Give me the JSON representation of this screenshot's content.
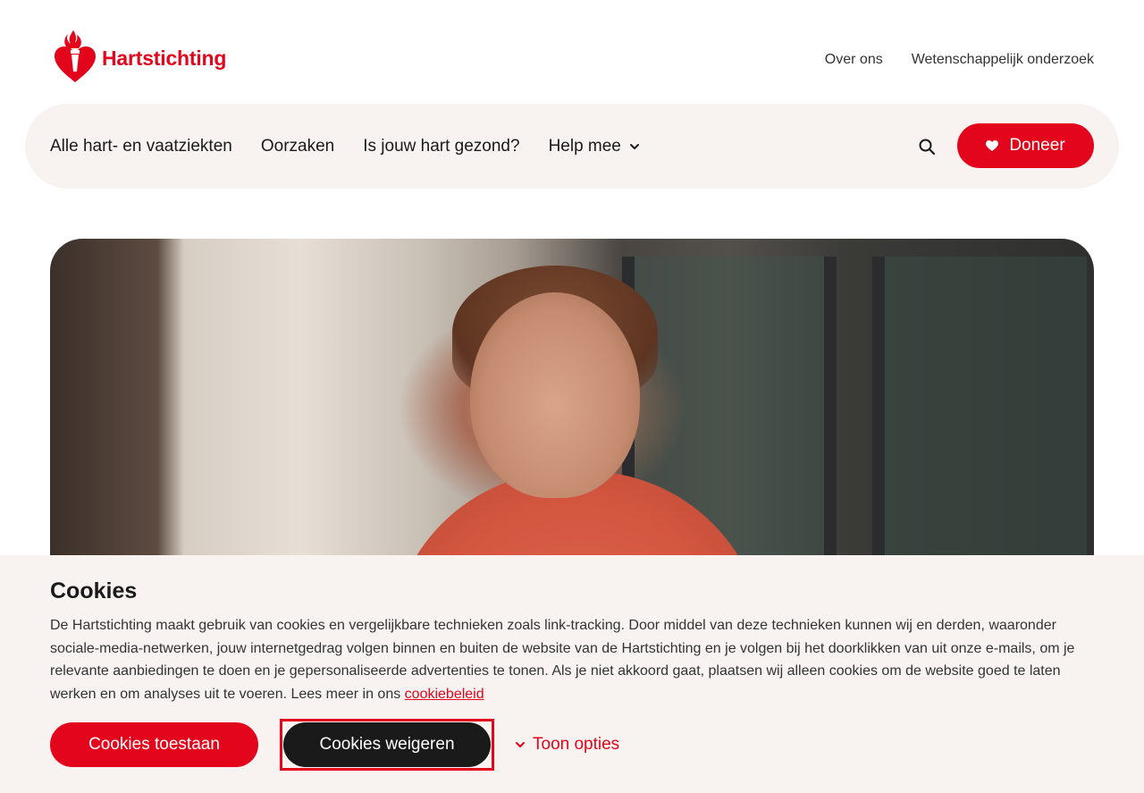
{
  "brand": {
    "name": "Hartstichting",
    "accent": "#e3051b",
    "logo_icon": "heart-torch-icon"
  },
  "utility_nav": [
    {
      "label": "Over ons"
    },
    {
      "label": "Wetenschappelijk onderzoek"
    }
  ],
  "main_nav": {
    "items": [
      {
        "label": "Alle hart- en vaatziekten"
      },
      {
        "label": "Oorzaken"
      },
      {
        "label": "Is jouw hart gezond?"
      },
      {
        "label": "Help mee",
        "has_dropdown": true
      }
    ],
    "search_icon": "search-icon",
    "donate_label": "Doneer",
    "donate_icon": "heart-icon"
  },
  "hero": {
    "image_description": ""
  },
  "cookie_banner": {
    "title": "Cookies",
    "body": "De Hartstichting maakt gebruik van cookies en vergelijkbare technieken zoals link-tracking. Door middel van deze technieken kunnen wij en derden, waaronder sociale-media-netwerken, jouw internetgedrag volgen binnen en buiten de website van de Hartstichting en je volgen bij het doorklikken van uit onze e-mails, om je relevante aanbiedingen te doen en je gepersonaliseerde advertenties te tonen. Als je niet akkoord gaat, plaatsen wij alleen cookies om de website goed te laten werken en om analyses uit te voeren. Lees meer in ons",
    "policy_link": "cookiebeleid",
    "allow_label": "Cookies toestaan",
    "deny_label": "Cookies weigeren",
    "options_label": "Toon opties"
  }
}
